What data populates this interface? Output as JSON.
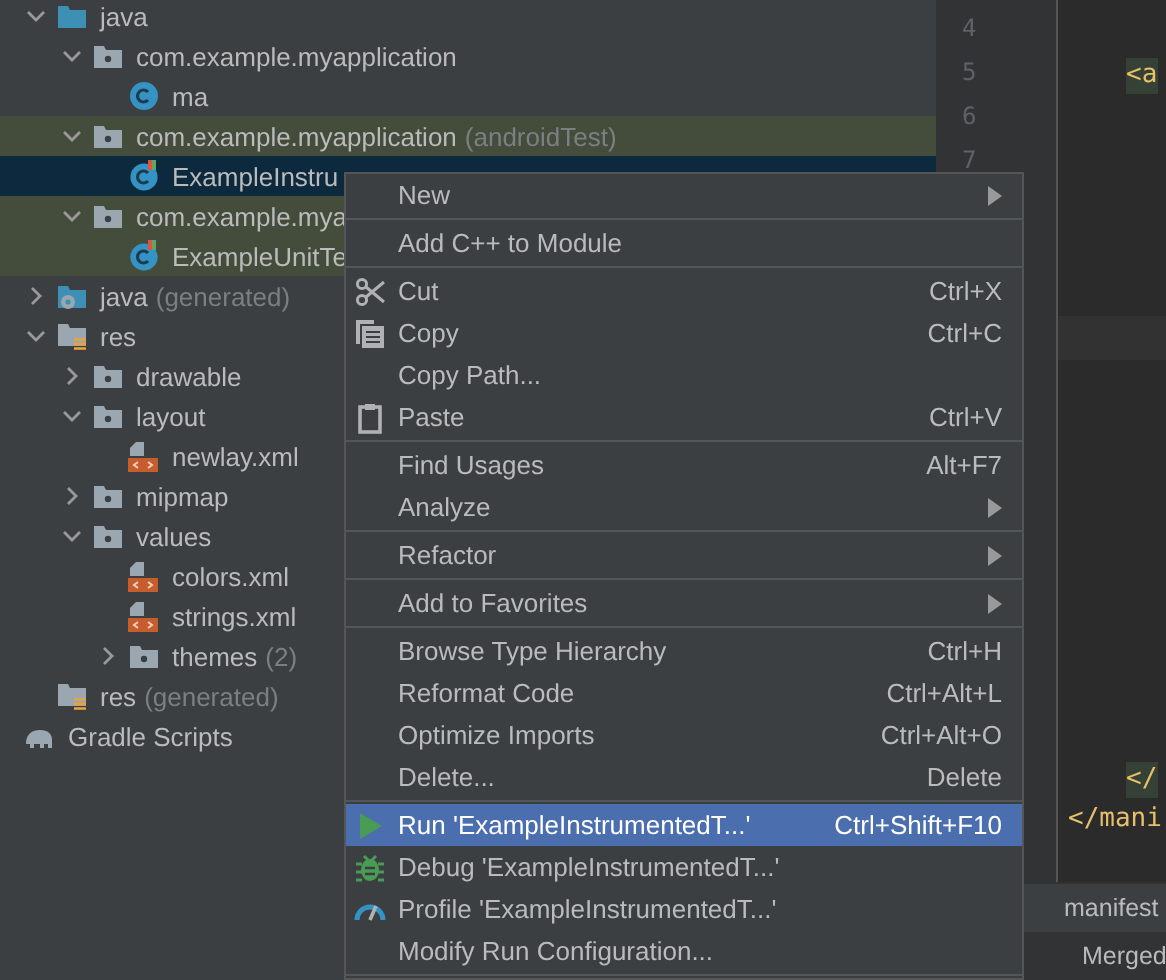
{
  "project_tree": [
    {
      "label": "java",
      "kind": "source",
      "expanded": true,
      "selected": false,
      "tinted": false,
      "children": [
        {
          "label": "com.example.myapplication",
          "kind": "package",
          "expanded": true,
          "selected": false,
          "tinted": false,
          "children": [
            {
              "label": "ma",
              "kind": "class",
              "selected": false,
              "tinted": false
            }
          ]
        },
        {
          "label": "com.example.myapplication",
          "suffix": "(androidTest)",
          "kind": "package",
          "expanded": true,
          "selected": false,
          "tinted": true,
          "children": [
            {
              "label": "ExampleInstru",
              "kind": "test",
              "selected": true
            }
          ]
        },
        {
          "label": "com.example.mya",
          "kind": "package",
          "expanded": true,
          "selected": false,
          "tinted": true,
          "children": [
            {
              "label": "ExampleUnitTe",
              "kind": "test",
              "selected": false,
              "tinted": true
            }
          ]
        }
      ]
    },
    {
      "label": "java",
      "suffix": "(generated)",
      "kind": "generated",
      "expanded": false,
      "selected": false,
      "tinted": false
    },
    {
      "label": "res",
      "kind": "resources",
      "expanded": true,
      "selected": false,
      "tinted": false,
      "children": [
        {
          "label": "drawable",
          "kind": "package",
          "expanded": false,
          "selected": false,
          "tinted": false
        },
        {
          "label": "layout",
          "kind": "package",
          "expanded": true,
          "selected": false,
          "tinted": false,
          "children": [
            {
              "label": "newlay.xml",
              "kind": "xml",
              "selected": false,
              "tinted": false
            }
          ]
        },
        {
          "label": "mipmap",
          "kind": "package",
          "expanded": false,
          "selected": false,
          "tinted": false
        },
        {
          "label": "values",
          "kind": "package",
          "expanded": true,
          "selected": false,
          "tinted": false,
          "children": [
            {
              "label": "colors.xml",
              "kind": "xml",
              "selected": false,
              "tinted": false
            },
            {
              "label": "strings.xml",
              "kind": "xml",
              "selected": false,
              "tinted": false
            },
            {
              "label": "themes",
              "suffix": "(2)",
              "kind": "package",
              "expanded": false,
              "selected": false,
              "tinted": false
            }
          ]
        }
      ]
    },
    {
      "label": "res",
      "suffix": "(generated)",
      "kind": "resources",
      "selected": false,
      "tinted": false
    }
  ],
  "gradle_scripts": {
    "label": "Gradle Scripts"
  },
  "editor": {
    "line_numbers": [
      "4",
      "5",
      "6",
      "7"
    ],
    "code_lines": [
      "<a",
      "</",
      "</mani"
    ],
    "bottom_tabs": [
      "manifest",
      "Merged"
    ]
  },
  "context_menu": [
    {
      "kind": "submenu",
      "label": "New",
      "selected": false
    },
    {
      "kind": "separator"
    },
    {
      "kind": "plain",
      "label": "Add C++ to Module",
      "selected": false
    },
    {
      "kind": "separator"
    },
    {
      "kind": "cut",
      "label": "Cut",
      "shortcut": "Ctrl+X",
      "selected": false
    },
    {
      "kind": "copy",
      "label": "Copy",
      "shortcut": "Ctrl+C",
      "selected": false
    },
    {
      "kind": "plain",
      "label": "Copy Path...",
      "selected": false
    },
    {
      "kind": "paste",
      "label": "Paste",
      "shortcut": "Ctrl+V",
      "selected": false
    },
    {
      "kind": "separator"
    },
    {
      "kind": "plain",
      "label": "Find Usages",
      "shortcut": "Alt+F7",
      "selected": false
    },
    {
      "kind": "submenu",
      "label": "Analyze",
      "selected": false
    },
    {
      "kind": "separator"
    },
    {
      "kind": "submenu",
      "label": "Refactor",
      "selected": false
    },
    {
      "kind": "separator"
    },
    {
      "kind": "submenu",
      "label": "Add to Favorites",
      "selected": false
    },
    {
      "kind": "separator"
    },
    {
      "kind": "plain",
      "label": "Browse Type Hierarchy",
      "shortcut": "Ctrl+H",
      "selected": false
    },
    {
      "kind": "plain",
      "label": "Reformat Code",
      "shortcut": "Ctrl+Alt+L",
      "selected": false
    },
    {
      "kind": "plain",
      "label": "Optimize Imports",
      "shortcut": "Ctrl+Alt+O",
      "selected": false
    },
    {
      "kind": "plain",
      "label": "Delete...",
      "shortcut": "Delete",
      "selected": false
    },
    {
      "kind": "separator"
    },
    {
      "kind": "run",
      "label": "Run 'ExampleInstrumentedT...'",
      "shortcut": "Ctrl+Shift+F10",
      "selected": true
    },
    {
      "kind": "debug",
      "label": "Debug 'ExampleInstrumentedT...'",
      "selected": false
    },
    {
      "kind": "profile",
      "label": "Profile 'ExampleInstrumentedT...'",
      "selected": false
    },
    {
      "kind": "plain",
      "label": "Modify Run Configuration...",
      "selected": false
    },
    {
      "kind": "separator"
    }
  ]
}
